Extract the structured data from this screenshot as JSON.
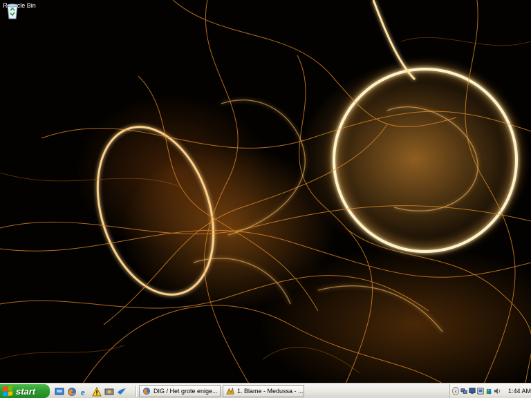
{
  "desktop": {
    "icons": [
      {
        "label": "Recycle Bin",
        "icon": "recycle-bin-icon"
      }
    ]
  },
  "taskbar": {
    "start_label": "start",
    "quick_launch": [
      {
        "icon": "show-desktop-icon"
      },
      {
        "icon": "firefox-icon"
      },
      {
        "icon": "internet-explorer-icon"
      },
      {
        "icon": "warning-icon"
      },
      {
        "icon": "media-icon"
      },
      {
        "icon": "messenger-bird-icon"
      }
    ],
    "tasks": [
      {
        "label": "DIG / Het grote enige...",
        "icon": "firefox-icon"
      },
      {
        "label": "1. Blame - Medussa - ...",
        "icon": "winamp-icon"
      }
    ],
    "tray": {
      "icons": [
        "network-icon",
        "display-icon",
        "monitor-icon",
        "messenger-icon",
        "volume-icon"
      ],
      "clock": "1:44 AM"
    }
  },
  "colors": {
    "start_green": "#2f9e2f",
    "taskbar_silver": "#e9e8e2",
    "wallpaper_glow": "#ffaa3c"
  }
}
